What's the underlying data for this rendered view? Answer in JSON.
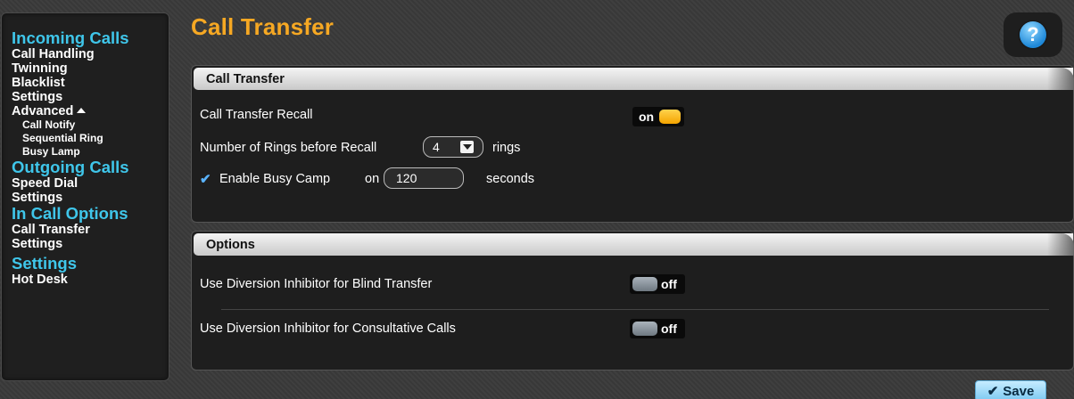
{
  "sidebar": {
    "groups": [
      {
        "title": "Incoming Calls",
        "items": [
          "Call Handling",
          "Twinning",
          "Blacklist",
          "Settings"
        ],
        "advanced": {
          "label": "Advanced",
          "subitems": [
            "Call Notify",
            "Sequential Ring",
            "Busy Lamp"
          ]
        }
      },
      {
        "title": "Outgoing Calls",
        "items": [
          "Speed Dial",
          "Settings"
        ]
      },
      {
        "title": "In Call Options",
        "items": [
          "Call Transfer",
          "Settings"
        ]
      },
      {
        "title": "Settings",
        "items": [
          "Hot Desk"
        ]
      }
    ]
  },
  "page": {
    "title": "Call Transfer",
    "help_label": "?"
  },
  "call_transfer_panel": {
    "header": "Call Transfer",
    "recall_label": "Call Transfer Recall",
    "recall_toggle": "on",
    "rings_label": "Number of Rings before Recall",
    "rings_value": "4",
    "rings_unit": "rings",
    "busy_camp_label": "Enable Busy Camp",
    "busy_camp_on": "on",
    "busy_camp_value": "120",
    "busy_camp_unit": "seconds"
  },
  "options_panel": {
    "header": "Options",
    "blind_label": "Use Diversion Inhibitor for Blind Transfer",
    "blind_toggle": "off",
    "consultative_label": "Use Diversion Inhibitor for Consultative Calls",
    "consultative_toggle": "off"
  },
  "footer": {
    "save_label": "Save"
  },
  "colors": {
    "title": "#f6a823",
    "group": "#3fc6ea",
    "toggle_on": "#f4a400",
    "toggle_off": "#6e7881",
    "save": "#7cc9f2"
  }
}
